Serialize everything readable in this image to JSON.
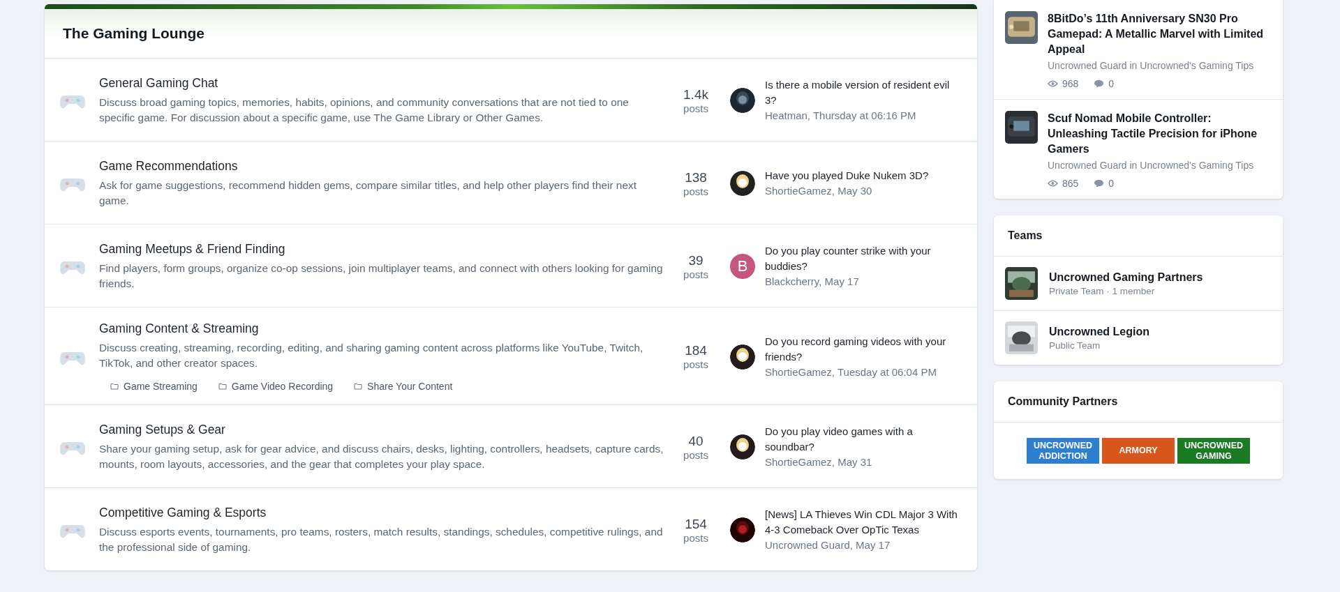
{
  "category": {
    "title": "The Gaming Lounge",
    "forums": [
      {
        "title": "General Gaming Chat",
        "description": "Discuss broad gaming topics, memories, habits, opinions, and community conversations that are not tied to one specific game. For discussion about a specific game, use The Game Library or Other Games.",
        "count": "1.4k",
        "count_label": "posts",
        "last_post": {
          "title": "Is there a mobile version of resident evil 3?",
          "meta": "Heatman, Thursday at 06:16 PM"
        }
      },
      {
        "title": "Game Recommendations",
        "description": "Ask for game suggestions, recommend hidden gems, compare similar titles, and help other players find their next game.",
        "count": "138",
        "count_label": "posts",
        "last_post": {
          "title": "Have you played Duke Nukem 3D?",
          "meta": "ShortieGamez, May 30"
        }
      },
      {
        "title": "Gaming Meetups & Friend Finding",
        "description": "Find players, form groups, organize co-op sessions, join multiplayer teams, and connect with others looking for gaming friends.",
        "count": "39",
        "count_label": "posts",
        "last_post": {
          "title": "Do you play counter strike with your buddies?",
          "meta": "Blackcherry, May 17",
          "avatar": {
            "kind": "letter",
            "letter": "B",
            "color": "#c4577f"
          }
        }
      },
      {
        "title": "Gaming Content & Streaming",
        "description": "Discuss creating, streaming, recording, editing, and sharing gaming content across platforms like YouTube, Twitch, TikTok, and other creator spaces.",
        "subforums": [
          "Game Streaming",
          "Game Video Recording",
          "Share Your Content"
        ],
        "count": "184",
        "count_label": "posts",
        "last_post": {
          "title": "Do you record gaming videos with your friends?",
          "meta": "ShortieGamez, Tuesday at 06:04 PM"
        }
      },
      {
        "title": "Gaming Setups & Gear",
        "description": "Share your gaming setup, ask for gear advice, and discuss chairs, desks, lighting, controllers, headsets, capture cards, mounts, room layouts, accessories, and the gear that completes your play space.",
        "count": "40",
        "count_label": "posts",
        "last_post": {
          "title": "Do you play video games with a soundbar?",
          "meta": "ShortieGamez, May 31"
        }
      },
      {
        "title": "Competitive Gaming & Esports",
        "description": "Discuss esports events, tournaments, pro teams, rosters, match results, standings, schedules, competitive rulings, and the professional side of gaming.",
        "count": "154",
        "count_label": "posts",
        "last_post": {
          "title": "[News] LA Thieves Win CDL Major 3 With 4-3 Comeback Over OpTic Texas",
          "meta": "Uncrowned Guard, May 17"
        }
      }
    ]
  },
  "sidebar": {
    "articles": [
      {
        "title": "8BitDo’s 11th Anniversary SN30 Pro Gamepad: A Metallic Marvel with Limited Appeal",
        "meta": "Uncrowned Guard in Uncrowned's Gaming Tips",
        "views": "968",
        "comments": "0"
      },
      {
        "title": "Scuf Nomad Mobile Controller: Unleashing Tactile Precision for iPhone Gamers",
        "meta": "Uncrowned Guard in Uncrowned's Gaming Tips",
        "views": "865",
        "comments": "0"
      }
    ],
    "teams": {
      "title": "Teams",
      "items": [
        {
          "name": "Uncrowned Gaming Partners",
          "meta": "Private Team · 1 member"
        },
        {
          "name": "Uncrowned Legion",
          "meta": "Public Team"
        }
      ]
    },
    "partners": {
      "title": "Community Partners",
      "banners": [
        {
          "lines": [
            "UNCROWNED",
            "ADDICTION"
          ],
          "color": "#2f7fd0"
        },
        {
          "lines": [
            "ARMORY"
          ],
          "color": "#d9561c"
        },
        {
          "lines": [
            "UNCROWNED",
            "GAMING"
          ],
          "color": "#1b7a24"
        }
      ]
    }
  }
}
